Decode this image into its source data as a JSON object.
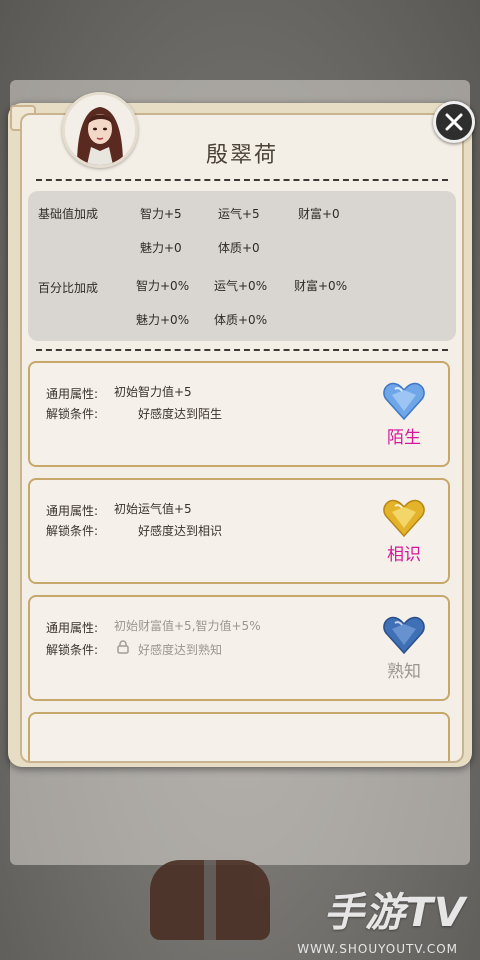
{
  "character": {
    "name": "殷翠荷"
  },
  "stats": {
    "base_label": "基础值加成",
    "base_values": [
      "智力+5",
      "运气+5",
      "财富+0",
      "魅力+0",
      "体质+0"
    ],
    "percent_label": "百分比加成",
    "percent_values": [
      "智力+0%",
      "运气+0%",
      "财富+0%",
      "魅力+0%",
      "体质+0%"
    ]
  },
  "cards": [
    {
      "attr_label": "通用属性:",
      "attr_value": "初始智力值+5",
      "cond_label": "解锁条件:",
      "cond_value": "好感度达到陌生",
      "level": "陌生",
      "level_color": "#d4189a",
      "heart_color": "#6fa6e8",
      "locked": false
    },
    {
      "attr_label": "通用属性:",
      "attr_value": "初始运气值+5",
      "cond_label": "解锁条件:",
      "cond_value": "好感度达到相识",
      "level": "相识",
      "level_color": "#d4189a",
      "heart_color": "#e3b32a",
      "locked": false
    },
    {
      "attr_label": "通用属性:",
      "attr_value": "初始财富值+5,智力值+5%",
      "cond_label": "解锁条件:",
      "cond_value": "好感度达到熟知",
      "level": "熟知",
      "level_color": "#9a9690",
      "heart_color": "#3f6fb5",
      "locked": true
    }
  ],
  "watermark": {
    "brand": "手游TV",
    "url": "WWW.SHOUYOUTV.COM"
  },
  "icons": {
    "close": "close-icon",
    "lock": "lock-icon",
    "heart": "heart-gem-icon"
  }
}
